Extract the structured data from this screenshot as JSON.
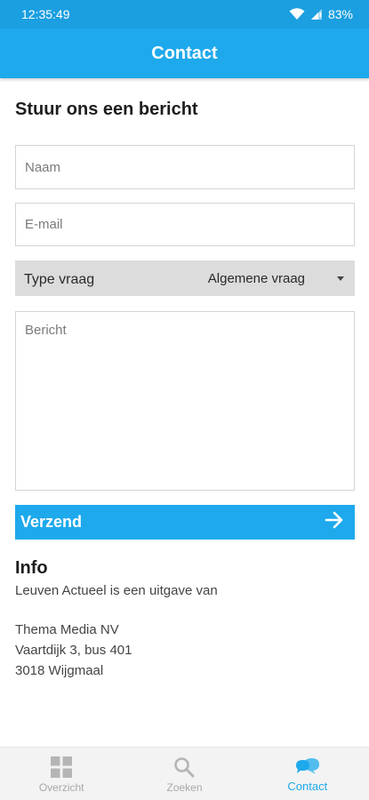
{
  "status_bar": {
    "time": "12:35:49",
    "battery": "83%",
    "icons": [
      "wifi-icon",
      "cell-signal-icon"
    ]
  },
  "app_bar": {
    "title": "Contact"
  },
  "form": {
    "title": "Stuur ons een bericht",
    "name_placeholder": "Naam",
    "email_placeholder": "E-mail",
    "type_label": "Type vraag",
    "type_value": "Algemene vraag",
    "message_placeholder": "Bericht",
    "send_label": "Verzend"
  },
  "info": {
    "title": "Info",
    "intro": "Leuven Actueel is een uitgave van",
    "company": "Thema Media NV",
    "street": "Vaartdijk 3, bus 401",
    "city": "3018 Wijgmaal"
  },
  "bottom_nav": {
    "items": [
      {
        "label": "Overzicht",
        "icon": "grid-icon",
        "active": false
      },
      {
        "label": "Zoeken",
        "icon": "search-icon",
        "active": false
      },
      {
        "label": "Contact",
        "icon": "chat-bubbles-icon",
        "active": true
      }
    ]
  },
  "colors": {
    "primary": "#1ea9ec",
    "status_bar": "#1b9fe0",
    "select_bg": "#dcdcdc",
    "nav_inactive": "#a8a8a8"
  }
}
